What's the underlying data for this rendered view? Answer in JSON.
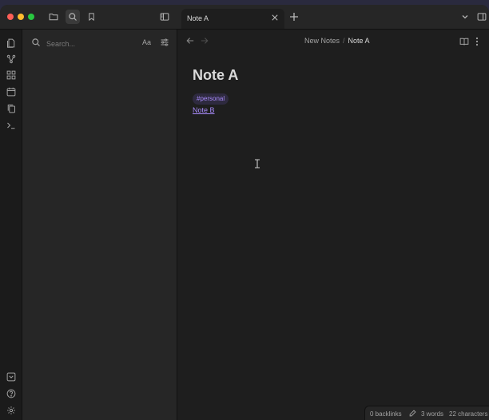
{
  "tab": {
    "label": "Note A"
  },
  "sidebar": {
    "search_placeholder": "Search...",
    "match_case_label": "Aa"
  },
  "breadcrumb": {
    "folder": "New Notes",
    "separator": "/",
    "current": "Note A"
  },
  "note": {
    "title": "Note A",
    "tag": "#personal",
    "link": "Note B"
  },
  "status": {
    "backlinks": "0 backlinks",
    "words": "3 words",
    "characters": "22 characters"
  },
  "colors": {
    "accent": "#a88bfa",
    "tag_bg": "#2e2a3f",
    "close": "#fe5f57",
    "minimize": "#febc2e",
    "maximize": "#28c840"
  }
}
